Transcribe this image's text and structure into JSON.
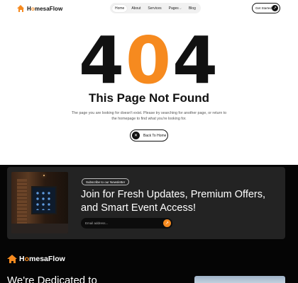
{
  "header": {
    "logo": {
      "prefix": "H",
      "o": "o",
      "suffix": "mesaFlow",
      "icon": "house-icon"
    },
    "nav": [
      {
        "label": "Home",
        "active": true
      },
      {
        "label": "About",
        "active": false
      },
      {
        "label": "Services",
        "active": false
      },
      {
        "label": "Pages",
        "active": false,
        "has_dropdown": true
      },
      {
        "label": "Blog",
        "active": false
      }
    ],
    "cta_label": "Get Started",
    "cta_icon": "arrow-up-right-icon"
  },
  "error": {
    "code_first": "4",
    "code_middle": "0",
    "code_last": "4",
    "title": "This Page Not Found",
    "description": "The page you are looking for doesn't exist. Please try searching for another page, or return to the homepage to find what you're looking for.",
    "button_label": "Back To Home",
    "button_icon": "close-icon"
  },
  "newsletter": {
    "badge": "Subscribe to our Newsletter",
    "title": "Join for Fresh Updates, Premium Offers, and Smart Event Access!",
    "email_placeholder": "Email address...",
    "submit_icon": "arrow-up-right-icon"
  },
  "footer": {
    "logo": {
      "prefix": "H",
      "o": "o",
      "suffix": "mesaFlow"
    },
    "heading": "We're Dedicated to"
  },
  "colors": {
    "accent": "#f68a1f",
    "dark": "#050505",
    "card": "#232323"
  }
}
